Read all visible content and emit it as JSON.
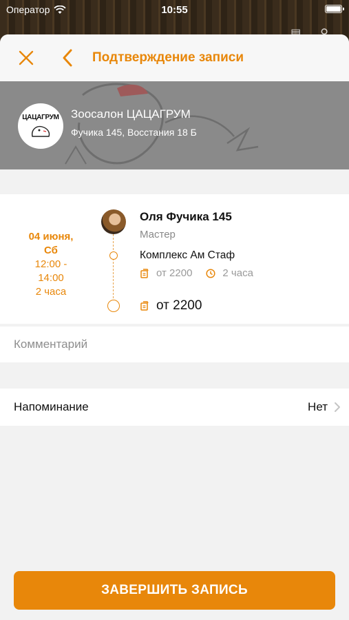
{
  "status_bar": {
    "carrier": "Оператор",
    "time": "10:55"
  },
  "nav": {
    "title": "Подтверждение записи"
  },
  "salon": {
    "name": "Зоосалон ЦАЦАГРУМ",
    "address": "Фучика 145, Восстания 18 Б",
    "logo_text": "ЦАЦАГРУМ"
  },
  "booking": {
    "date": "04 июня,",
    "weekday": "Сб",
    "time_from": "12:00 -",
    "time_to": "14:00",
    "duration": "2 часа",
    "master_name": "Оля Фучика 145",
    "master_role": "Мастер",
    "service_name": "Комплекс Ам Стаф",
    "service_price": "от 2200",
    "service_duration": "2 часа",
    "total_price": "от 2200"
  },
  "comment": {
    "placeholder": "Комментарий",
    "value": ""
  },
  "reminder": {
    "label": "Напоминание",
    "value": "Нет"
  },
  "finish_button": {
    "label": "ЗАВЕРШИТЬ ЗАПИСЬ"
  },
  "colors": {
    "accent": "#e8870a",
    "background": "#f2f2f2"
  }
}
